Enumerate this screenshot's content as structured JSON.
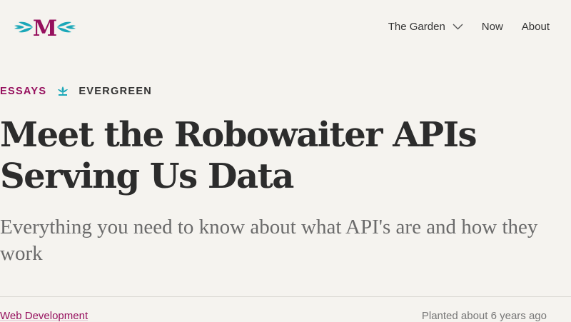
{
  "header": {
    "logo_letter": "M",
    "nav": [
      {
        "label": "The Garden",
        "has_dropdown": true
      },
      {
        "label": "Now"
      },
      {
        "label": "About"
      }
    ]
  },
  "article": {
    "category": "ESSAYS",
    "growth_stage": "EVERGREEN",
    "title": "Meet the Robowaiter APIs Serving Us Data",
    "subtitle": "Everything you need to know about what API's are and how they work",
    "topic": "Web Development",
    "planted": "Planted about 6 years ago"
  },
  "colors": {
    "accent": "#96105e",
    "teal": "#1aa7b8",
    "background": "#f5f3ef",
    "text": "#2f2f2f"
  },
  "icons": {
    "logo": "leaf-m-logo",
    "dropdown": "chevron-down-icon",
    "growth_stage": "evergreen-plant-icon"
  }
}
